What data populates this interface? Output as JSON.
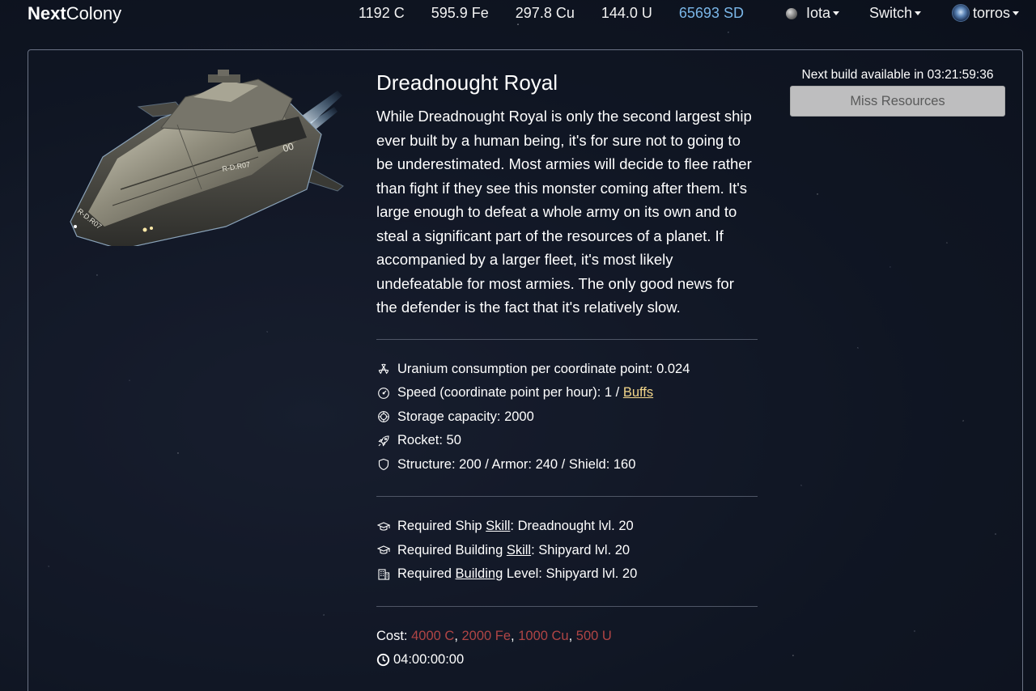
{
  "nav": {
    "brand_bold": "Next",
    "brand_light": "Colony",
    "resources": {
      "coal": "1192 C",
      "iron": "595.9 Fe",
      "copper": "297.8 Cu",
      "uranium": "144.0 U",
      "stardust": "65693 SD"
    },
    "planet": "Iota",
    "switch": "Switch",
    "user": "torros"
  },
  "ship": {
    "name": "Dreadnought Royal",
    "description": "While Dreadnought Royal is only the second largest ship ever built by a human being, it's for sure not to going to be underestimated. Most armies will decide to flee rather than fight if they see this monster coming after them. It's large enough to defeat a whole army on its own and to steal a significant part of the resources of a planet. If accompanied by a larger fleet, it's most likely undefeatable for most armies. The only good news for the defender is the fact that it's relatively slow.",
    "hull_label": "R-D.R07",
    "nose_label": "R-D.R07",
    "fin_label": "00",
    "stats": {
      "uranium": "Uranium consumption per coordinate point: 0.024",
      "speed_prefix": "Speed (coordinate point per hour): 1 / ",
      "speed_link": "Buffs",
      "storage": "Storage capacity: 2000",
      "rocket": "Rocket: 50",
      "defense": "Structure: 200 / Armor: 240 / Shield: 160"
    },
    "requirements": {
      "ship_skill_pre": "Required Ship ",
      "ship_skill_link": "Skill",
      "ship_skill_post": ": Dreadnought lvl. 20",
      "building_skill_pre": "Required Building ",
      "building_skill_link": "Skill",
      "building_skill_post": ": Shipyard lvl. 20",
      "building_level_pre": "Required ",
      "building_level_link": "Building",
      "building_level_post": " Level: Shipyard lvl. 20"
    },
    "cost": {
      "label": "Cost: ",
      "coal": "4000 C",
      "iron": "2000 Fe",
      "copper": "1000 Cu",
      "uranium": "500 U",
      "separator": ", ",
      "time": "04:00:00:00"
    }
  },
  "build": {
    "next_build": "Next build available in 03:21:59:36",
    "button": "Miss Resources"
  },
  "colors": {
    "background": "#0f1522",
    "stardust": "#7ab6e8",
    "cost_missing": "#b04545",
    "buffs_link": "#f3d68a",
    "button_disabled": "#c8c8c8"
  }
}
